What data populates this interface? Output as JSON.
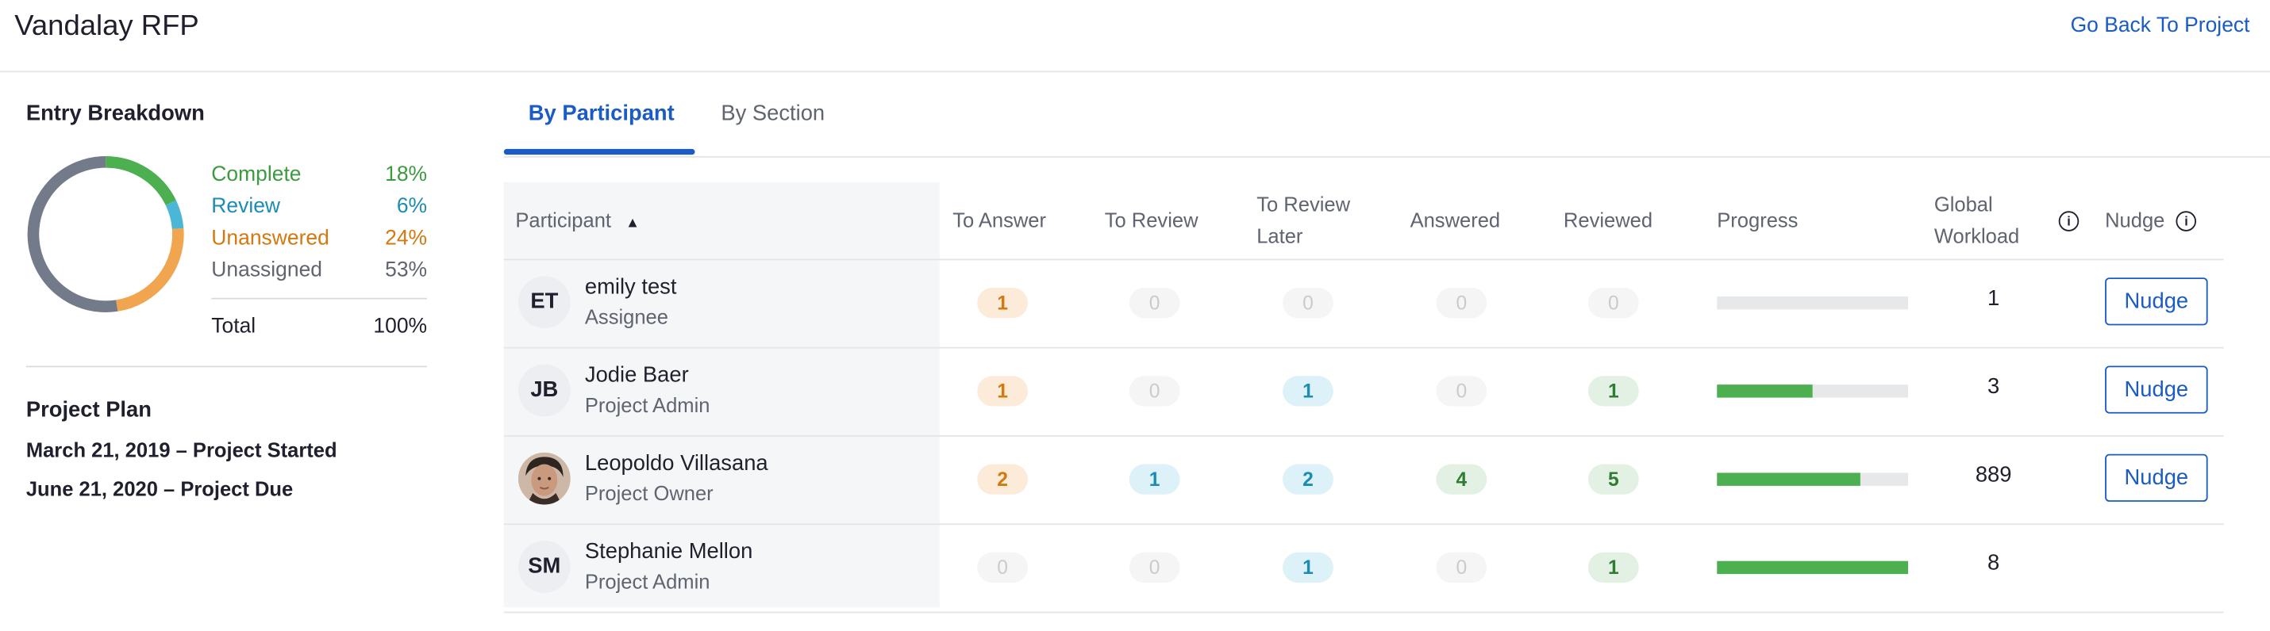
{
  "header": {
    "title": "Vandalay RFP",
    "back_link": "Go Back To Project"
  },
  "breakdown": {
    "title": "Entry Breakdown",
    "items": [
      {
        "label": "Complete",
        "percent": "18%",
        "value": 18,
        "color": "#4caf50"
      },
      {
        "label": "Review",
        "percent": "6%",
        "value": 6,
        "color": "#4bb6d6"
      },
      {
        "label": "Unanswered",
        "percent": "24%",
        "value": 24,
        "color": "#f0a54e"
      },
      {
        "label": "Unassigned",
        "percent": "53%",
        "value": 53,
        "color": "#737b8a"
      }
    ],
    "total_label": "Total",
    "total_percent": "100%"
  },
  "plan": {
    "title": "Project Plan",
    "started": "March 21, 2019 – Project Started",
    "due": "June 21, 2020 – Project Due"
  },
  "tabs": [
    {
      "label": "By Participant"
    },
    {
      "label": "By Section"
    }
  ],
  "table": {
    "headers": {
      "participant": "Participant",
      "sort_indicator": "▲",
      "to_answer": "To Answer",
      "to_review": "To Review",
      "to_review_later": "To Review Later",
      "answered": "Answered",
      "reviewed": "Reviewed",
      "progress": "Progress",
      "global_workload": "Global Workload",
      "nudge": "Nudge"
    },
    "rows": [
      {
        "initials": "ET",
        "name": "emily test",
        "role": "Assignee",
        "to_answer": "1",
        "to_review": "0",
        "to_review_later": "0",
        "answered": "0",
        "reviewed": "0",
        "progress": 0,
        "workload": "1",
        "nudge": "Nudge"
      },
      {
        "initials": "JB",
        "name": "Jodie Baer",
        "role": "Project Admin",
        "to_answer": "1",
        "to_review": "0",
        "to_review_later": "1",
        "answered": "0",
        "reviewed": "1",
        "progress": 0.5,
        "workload": "3",
        "nudge": "Nudge"
      },
      {
        "initials": "",
        "name": "Leopoldo Villasana",
        "role": "Project Owner",
        "to_answer": "2",
        "to_review": "1",
        "to_review_later": "2",
        "answered": "4",
        "reviewed": "5",
        "progress": 0.75,
        "workload": "889",
        "nudge": "Nudge"
      },
      {
        "initials": "SM",
        "name": "Stephanie Mellon",
        "role": "Project Admin",
        "to_answer": "0",
        "to_review": "0",
        "to_review_later": "1",
        "answered": "0",
        "reviewed": "1",
        "progress": 1.0,
        "workload": "8",
        "nudge": ""
      }
    ]
  },
  "colors": {
    "accent": "#1a5bc4",
    "progress": "#4caf50"
  },
  "icons": {
    "info": "info-circle-icon",
    "sort": "sort-ascending-icon"
  }
}
